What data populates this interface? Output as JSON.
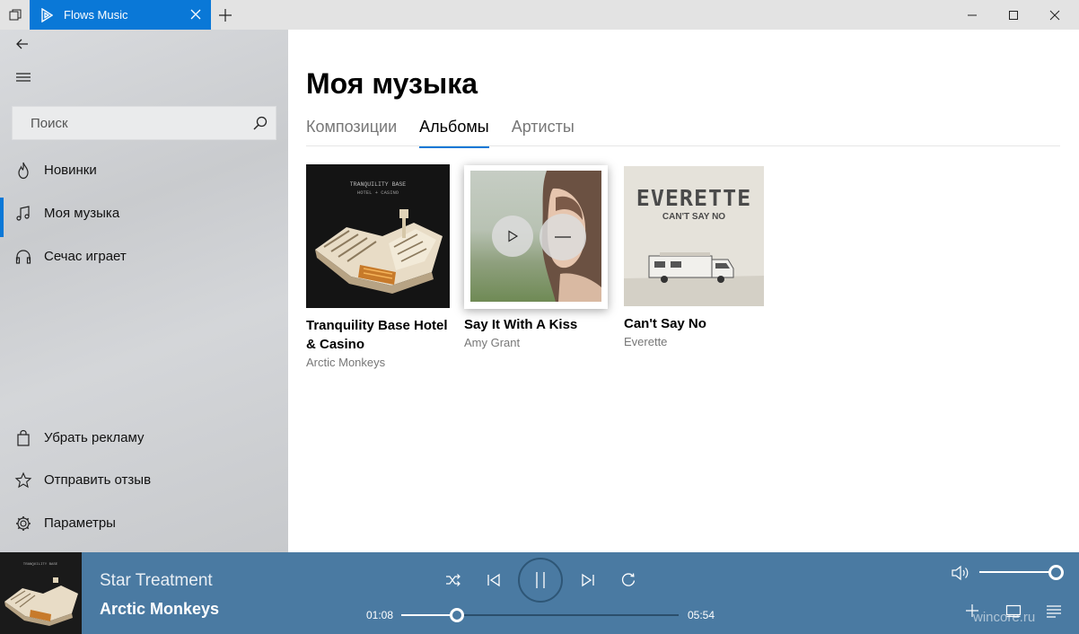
{
  "titlebar": {
    "tab_title": "Flows Music"
  },
  "sidebar": {
    "search_placeholder": "Поиск",
    "nav_top": [
      {
        "label": "Новинки",
        "icon": "flame-icon"
      },
      {
        "label": "Моя музыка",
        "icon": "music-note-icon"
      },
      {
        "label": "Сечас играет",
        "icon": "headphones-icon"
      }
    ],
    "nav_bottom": [
      {
        "label": "Убрать рекламу",
        "icon": "shopping-bag-icon"
      },
      {
        "label": "Отправить отзыв",
        "icon": "star-icon"
      },
      {
        "label": "Параметры",
        "icon": "gear-icon"
      }
    ],
    "selected_index": 1
  },
  "main": {
    "title": "Моя музыка",
    "tabs": [
      "Композиции",
      "Альбомы",
      "Артисты"
    ],
    "active_tab": 1,
    "albums": [
      {
        "title_line1": "Tranquility Base Hotel",
        "title_line2": "& Casino",
        "artist": "Arctic Monkeys",
        "cover_text_1": "TRANQUILITY BASE",
        "cover_text_2": "HOTEL + CASINO"
      },
      {
        "title_line1": "Say It With A Kiss",
        "title_line2": "",
        "artist": "Amy Grant"
      },
      {
        "title_line1": "Can't Say No",
        "title_line2": "",
        "artist": "Everette",
        "cover_text_1": "EVERETTE",
        "cover_text_2": "CAN'T SAY NO"
      }
    ]
  },
  "player": {
    "track_title": "Star Treatment",
    "track_artist": "Arctic Monkeys",
    "elapsed": "01:08",
    "duration": "05:54",
    "progress_fraction": 0.2,
    "volume_fraction": 1.0,
    "watermark": "wincore.ru"
  },
  "colors": {
    "accent": "#0a78d7",
    "player_bg": "#4a7aa2"
  }
}
